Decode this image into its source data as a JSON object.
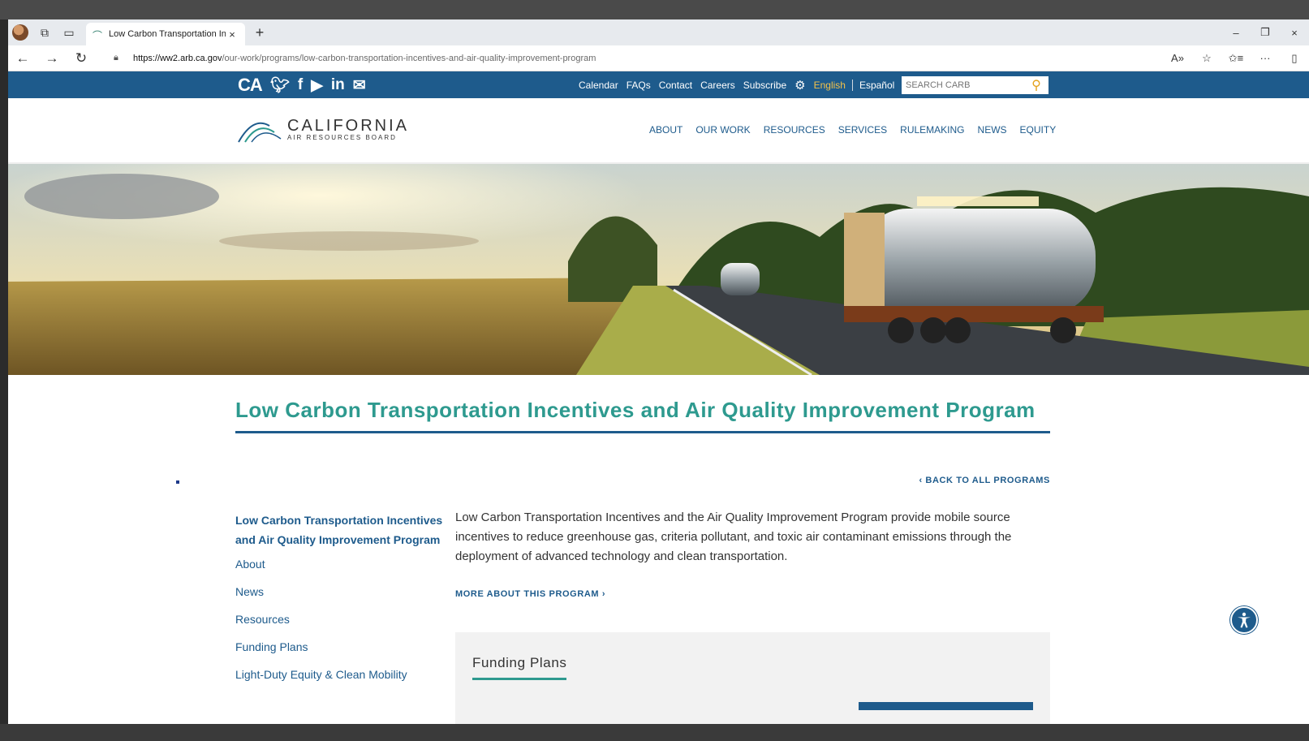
{
  "browser": {
    "tab_title": "Low Carbon Transportation Incen",
    "tab_close": "×",
    "new_tab": "+",
    "url_host": "https://ww2.arb.ca.gov",
    "url_path": "/our-work/programs/low-carbon-transportation-incentives-and-air-quality-improvement-program",
    "window_controls": [
      "–",
      "❐",
      "×"
    ]
  },
  "utility_bar": {
    "links": [
      "Calendar",
      "FAQs",
      "Contact",
      "Careers",
      "Subscribe"
    ],
    "lang_active": "English",
    "lang_other": "Español",
    "search_placeholder": "SEARCH CARB",
    "social": [
      "CA",
      "twitter",
      "facebook",
      "youtube",
      "in",
      "email"
    ]
  },
  "header": {
    "logo_main": "CALIFORNIA",
    "logo_sub": "AIR RESOURCES BOARD",
    "nav": [
      "ABOUT",
      "OUR WORK",
      "RESOURCES",
      "SERVICES",
      "RULEMAKING",
      "NEWS",
      "EQUITY"
    ]
  },
  "main": {
    "title": "Low Carbon Transportation Incentives and Air Quality Improvement Program",
    "back_link": "‹ BACK TO ALL PROGRAMS",
    "sidebar_title": "Low Carbon Transportation Incentives and Air Quality Improvement Program",
    "sidebar_items": [
      "About",
      "News",
      "Resources",
      "Funding Plans",
      "Light-Duty Equity & Clean Mobility"
    ],
    "intro": "Low Carbon Transportation Incentives and the Air Quality Improvement Program provide mobile source incentives to reduce greenhouse gas, criteria pollutant, and toxic air contaminant emissions through the deployment of advanced technology and clean transportation.",
    "more_link": "MORE ABOUT THIS PROGRAM ›",
    "funding_heading": "Funding Plans"
  },
  "colors": {
    "brand_blue": "#1e5b8c",
    "teal": "#2e9a8f",
    "english_gold": "#f3c24a"
  }
}
